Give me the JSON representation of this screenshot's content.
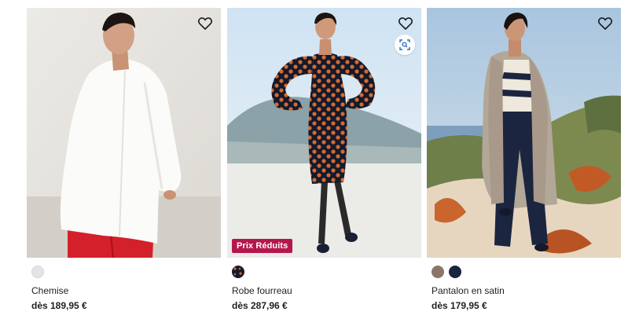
{
  "products": [
    {
      "name": "Chemise",
      "price": "dès 189,95 €",
      "swatches": [
        "light-grey"
      ],
      "badge": ""
    },
    {
      "name": "Robe fourreau",
      "price": "dès 287,96 €",
      "swatches": [
        "navy-orange-polka-dot"
      ],
      "badge": "Prix Réduits"
    },
    {
      "name": "Pantalon en satin",
      "price": "dès 179,95 €",
      "swatches": [
        "taupe",
        "navy"
      ],
      "badge": ""
    }
  ],
  "icons": {
    "favorite": "heart-outline-icon",
    "zoom": "visual-search-icon"
  },
  "colors": {
    "badge_background": "#b5174d",
    "text": "#1f1f1f"
  }
}
